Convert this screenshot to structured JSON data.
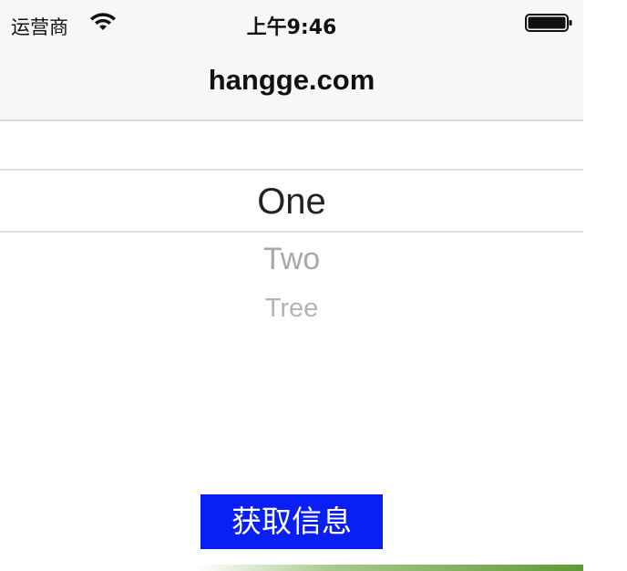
{
  "status_bar": {
    "carrier": "运营商",
    "time": "上午9:46",
    "wifi_icon": "wifi-icon",
    "battery_icon": "battery-icon"
  },
  "nav_bar": {
    "title": "hangge.com"
  },
  "picker": {
    "selected_index": 0,
    "items": [
      "One",
      "Two",
      "Tree"
    ]
  },
  "button": {
    "label": "获取信息",
    "color": "#0a1ff5"
  },
  "colors": {
    "nav_background": "#f7f7f7",
    "strip_green": "#5e9b33"
  }
}
